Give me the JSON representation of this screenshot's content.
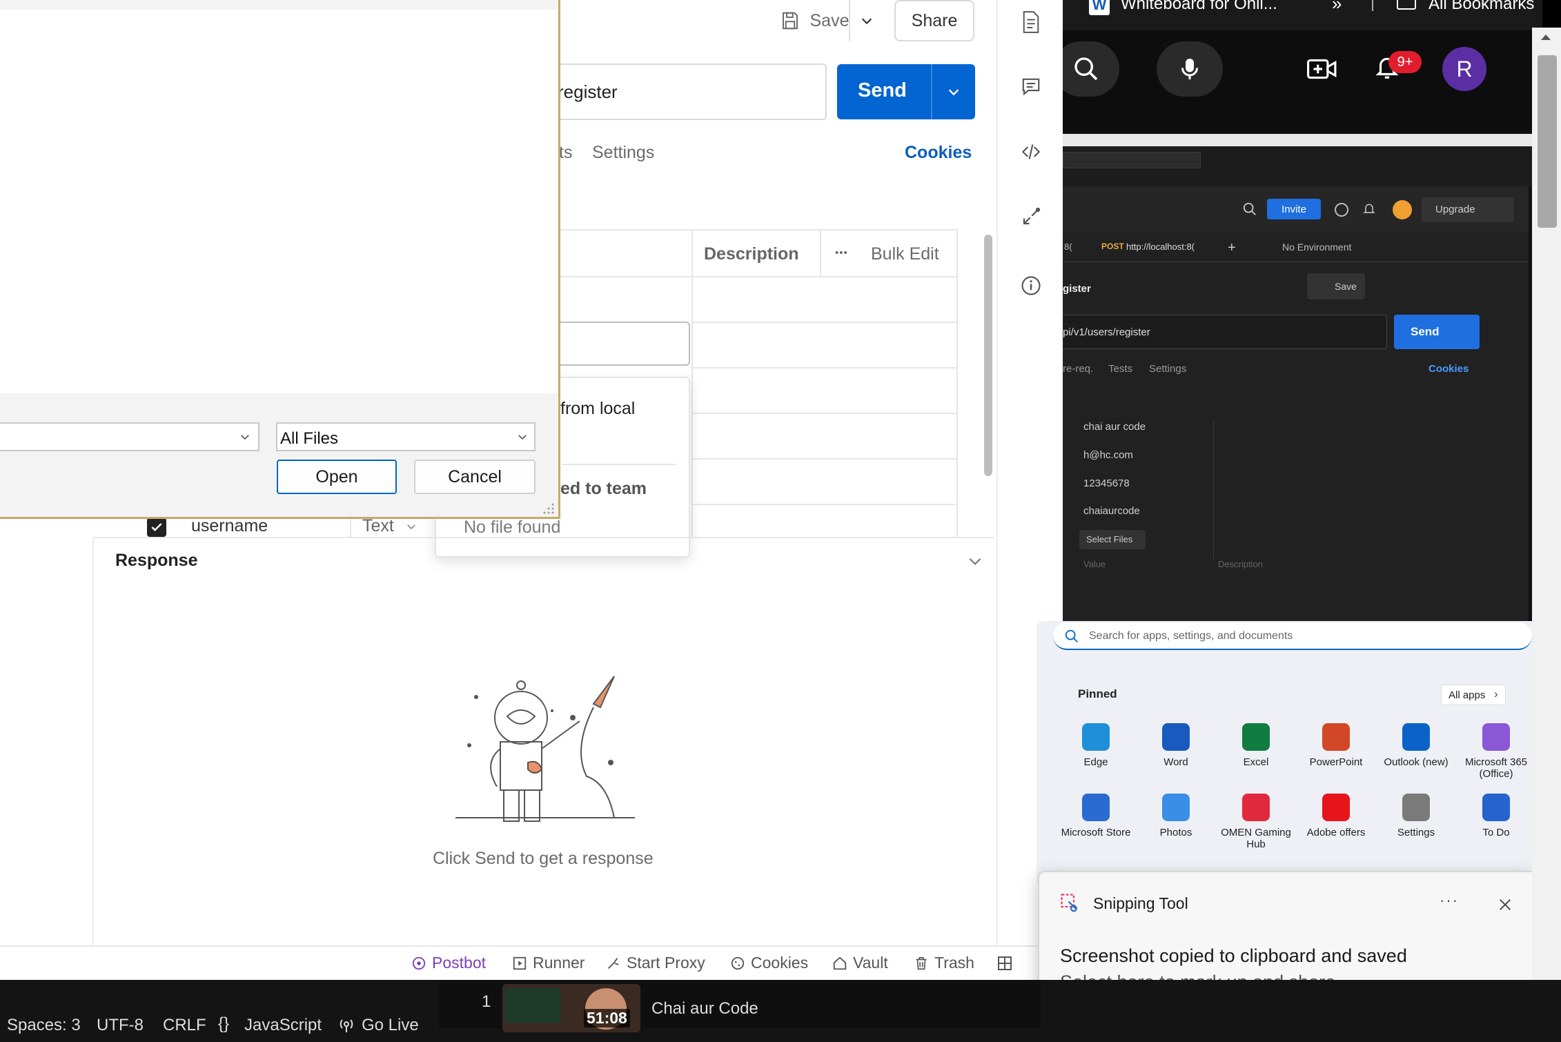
{
  "postman": {
    "save_label": "Save",
    "share_label": "Share",
    "url_fragment": "register",
    "send_label": "Send",
    "tab_fragment": "ts",
    "settings_tab": "Settings",
    "cookies_link": "Cookies",
    "table": {
      "description_header": "Description",
      "more_glyph": "•••",
      "bulk_edit": "Bulk Edit"
    },
    "file_popup": {
      "option1": "from local",
      "option2": "ed to team",
      "empty": "No file found"
    },
    "username_row": {
      "key": "username",
      "type": "Text"
    },
    "response_title": "Response",
    "empty_response": "Click Send to get a response",
    "footer": {
      "postbot": "Postbot",
      "runner": "Runner",
      "start_proxy": "Start Proxy",
      "cookies": "Cookies",
      "vault": "Vault",
      "trash": "Trash"
    }
  },
  "file_dialog": {
    "filter_value": "All Files",
    "open_label": "Open",
    "cancel_label": "Cancel"
  },
  "meeting": {
    "tab_title": "Whiteboard for Onli...",
    "bookmarks": "All Bookmarks",
    "notification_badge": "9+",
    "avatar_letter": "R"
  },
  "dark_postman": {
    "invite": "Invite",
    "upgrade": "Upgrade",
    "tab_prefix": "8(",
    "tab_method": "POST",
    "tab_url": "http://localhost:8(",
    "environment": "No Environment",
    "request_name": "gister",
    "save": "Save",
    "url": "pi/v1/users/register",
    "send": "Send",
    "tabs": [
      "re-req.",
      "Tests",
      "Settings"
    ],
    "cookies": "Cookies",
    "rows": [
      "chai aur code",
      "h@hc.com",
      "12345678",
      "chaiaurcode"
    ],
    "select_files": "Select Files",
    "value_placeholder": "Value",
    "description_placeholder": "Description"
  },
  "start_menu": {
    "search_placeholder": "Search for apps, settings, and documents",
    "pinned_label": "Pinned",
    "all_apps": "All apps",
    "apps": [
      {
        "name": "Edge",
        "color": "#1e8fd8"
      },
      {
        "name": "Word",
        "color": "#185abd"
      },
      {
        "name": "Excel",
        "color": "#107c41"
      },
      {
        "name": "PowerPoint",
        "color": "#d24726"
      },
      {
        "name": "Outlook (new)",
        "color": "#0a64c8"
      },
      {
        "name": "Microsoft 365 (Office)",
        "color": "#8a57d6"
      },
      {
        "name": "Microsoft Store",
        "color": "#2a6bd1"
      },
      {
        "name": "Photos",
        "color": "#3a8ee6"
      },
      {
        "name": "OMEN Gaming Hub",
        "color": "#e0293d"
      },
      {
        "name": "Adobe offers",
        "color": "#e8141c"
      },
      {
        "name": "Settings",
        "color": "#7a7a7a"
      },
      {
        "name": "To Do",
        "color": "#2564cf"
      }
    ]
  },
  "snipping_toast": {
    "app_name": "Snipping Tool",
    "title": "Screenshot copied to clipboard and saved",
    "subtitle": "Select here to mark up and share."
  },
  "status_bar": {
    "spaces": "Spaces: 3",
    "encoding": "UTF-8",
    "eol": "CRLF",
    "language": "JavaScript",
    "go_live": "Go Live"
  },
  "video_item": {
    "index": "1",
    "duration": "51:08",
    "channel": "Chai aur Code"
  }
}
